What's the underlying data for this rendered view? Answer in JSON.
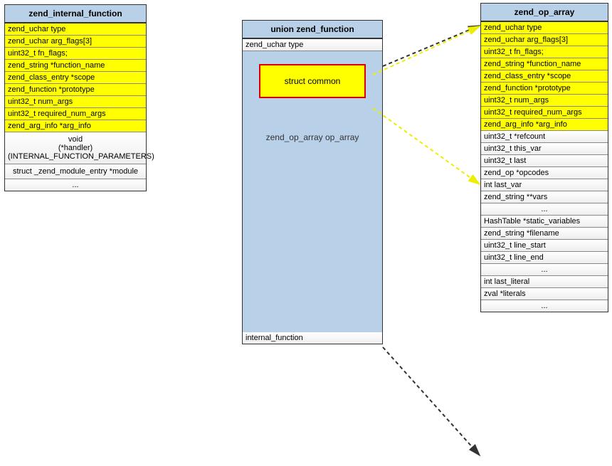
{
  "zend_internal_function": {
    "title": "zend_internal_function",
    "fields": [
      {
        "text": "zend_uchar type",
        "yellow": true
      },
      {
        "text": "zend_uchar arg_flags[3]",
        "yellow": true
      },
      {
        "text": "uint32_t fn_flags;",
        "yellow": true
      },
      {
        "text": "zend_string *function_name",
        "yellow": true
      },
      {
        "text": "zend_class_entry *scope",
        "yellow": true
      },
      {
        "text": "zend_function *prototype",
        "yellow": true
      },
      {
        "text": "uint32_t num_args",
        "yellow": true
      },
      {
        "text": "uint32_t required_num_args",
        "yellow": true
      },
      {
        "text": "zend_arg_info *arg_info",
        "yellow": true
      },
      {
        "text": "void\n(*handler)(INTERNAL_FUNCTION_PARAMETERS)",
        "yellow": false,
        "center": true,
        "multiline": true
      },
      {
        "text": "struct _zend_module_entry *module",
        "yellow": false,
        "center": true,
        "multiline": true
      },
      {
        "text": "...",
        "yellow": false,
        "center": true
      }
    ]
  },
  "zend_function": {
    "title": "union zend_function",
    "type_field": "zend_uchar type",
    "common_label": "struct common",
    "op_array_label": "zend_op_array op_array",
    "internal_label": "internal_function"
  },
  "zend_op_array": {
    "title": "zend_op_array",
    "fields": [
      {
        "text": "zend_uchar type",
        "yellow": true
      },
      {
        "text": "zend_uchar arg_flags[3]",
        "yellow": true
      },
      {
        "text": "uint32_t fn_flags;",
        "yellow": true
      },
      {
        "text": "zend_string *function_name",
        "yellow": true
      },
      {
        "text": "zend_class_entry *scope",
        "yellow": true
      },
      {
        "text": "zend_function *prototype",
        "yellow": true
      },
      {
        "text": "uint32_t num_args",
        "yellow": true
      },
      {
        "text": "uint32_t required_num_args",
        "yellow": true
      },
      {
        "text": "zend_arg_info *arg_info",
        "yellow": true
      },
      {
        "text": "uint32_t *refcount",
        "yellow": false
      },
      {
        "text": "uint32_t this_var",
        "yellow": false
      },
      {
        "text": "uint32_t last",
        "yellow": false
      },
      {
        "text": "zend_op *opcodes",
        "yellow": false
      },
      {
        "text": "int last_var",
        "yellow": false
      },
      {
        "text": "zend_string **vars",
        "yellow": false
      },
      {
        "text": "...",
        "yellow": false,
        "center": true
      },
      {
        "text": "HashTable *static_variables",
        "yellow": false
      },
      {
        "text": "zend_string *filename",
        "yellow": false
      },
      {
        "text": "uint32_t line_start",
        "yellow": false
      },
      {
        "text": "uint32_t line_end",
        "yellow": false
      },
      {
        "text": "...",
        "yellow": false,
        "center": true
      },
      {
        "text": "int last_literal",
        "yellow": false
      },
      {
        "text": "zval *literals",
        "yellow": false
      },
      {
        "text": "...",
        "yellow": false,
        "center": true
      }
    ]
  },
  "chart_data": {
    "type": "diagram",
    "structs": [
      {
        "name": "zend_internal_function",
        "common_fields": [
          "zend_uchar type",
          "zend_uchar arg_flags[3]",
          "uint32_t fn_flags;",
          "zend_string *function_name",
          "zend_class_entry *scope",
          "zend_function *prototype",
          "uint32_t num_args",
          "uint32_t required_num_args",
          "zend_arg_info *arg_info"
        ],
        "extra_fields": [
          "void (*handler)(INTERNAL_FUNCTION_PARAMETERS)",
          "struct _zend_module_entry *module",
          "..."
        ]
      },
      {
        "name": "union zend_function",
        "members": [
          "zend_uchar type",
          "struct common",
          "zend_op_array op_array",
          "internal_function"
        ]
      },
      {
        "name": "zend_op_array",
        "common_fields": [
          "zend_uchar type",
          "zend_uchar arg_flags[3]",
          "uint32_t fn_flags;",
          "zend_string *function_name",
          "zend_class_entry *scope",
          "zend_function *prototype",
          "uint32_t num_args",
          "uint32_t required_num_args",
          "zend_arg_info *arg_info"
        ],
        "extra_fields": [
          "uint32_t *refcount",
          "uint32_t this_var",
          "uint32_t last",
          "zend_op *opcodes",
          "int last_var",
          "zend_string **vars",
          "...",
          "HashTable *static_variables",
          "zend_string *filename",
          "uint32_t line_start",
          "uint32_t line_end",
          "...",
          "int last_literal",
          "zval *literals",
          "..."
        ]
      }
    ],
    "relationships": [
      {
        "from": "zend_function.struct common",
        "to": "zend_op_array.common_fields",
        "style": "yellow-dashed",
        "meaning": "common header maps to first 9 fields"
      },
      {
        "from": "zend_function.zend_op_array op_array",
        "to": "zend_op_array",
        "style": "black-dashed",
        "meaning": "union member expands to full struct"
      }
    ]
  }
}
